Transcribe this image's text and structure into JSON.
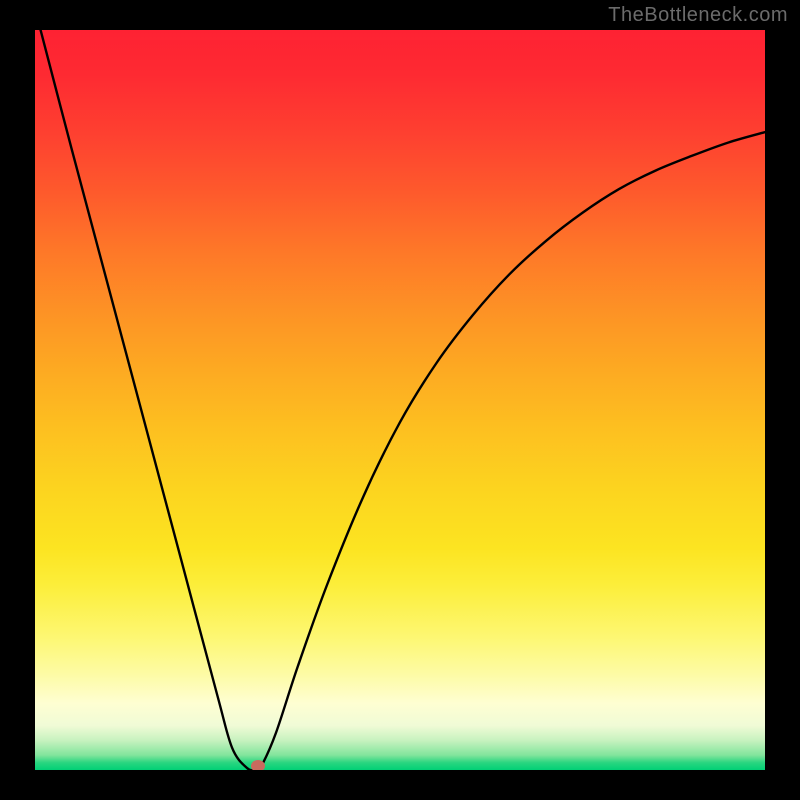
{
  "watermark": "TheBottleneck.com",
  "chart_data": {
    "type": "line",
    "title": "",
    "xlabel": "",
    "ylabel": "",
    "xlim": [
      0,
      100
    ],
    "ylim": [
      0,
      100
    ],
    "gradient_meaning": "top = high bottleneck (red), bottom = optimal (green)",
    "series": [
      {
        "name": "bottleneck-curve",
        "x": [
          0.5,
          5,
          10,
          15,
          20,
          25,
          27,
          29,
          30.3,
          31,
          33,
          36,
          40,
          45,
          50,
          55,
          60,
          65,
          70,
          75,
          80,
          85,
          90,
          95,
          100
        ],
        "y": [
          101,
          84,
          65.5,
          47,
          28.5,
          10,
          3,
          0.3,
          0,
          0.5,
          5,
          14,
          25,
          37,
          47,
          55,
          61.5,
          67,
          71.5,
          75.3,
          78.5,
          81,
          83,
          84.8,
          86.2
        ]
      }
    ],
    "marker": {
      "x": 30.6,
      "y": 0.5,
      "color": "#c96a5e"
    },
    "colors": {
      "curve": "#000000",
      "background_frame": "#000000",
      "top": "#fe2233",
      "bottom": "#01d076"
    }
  }
}
